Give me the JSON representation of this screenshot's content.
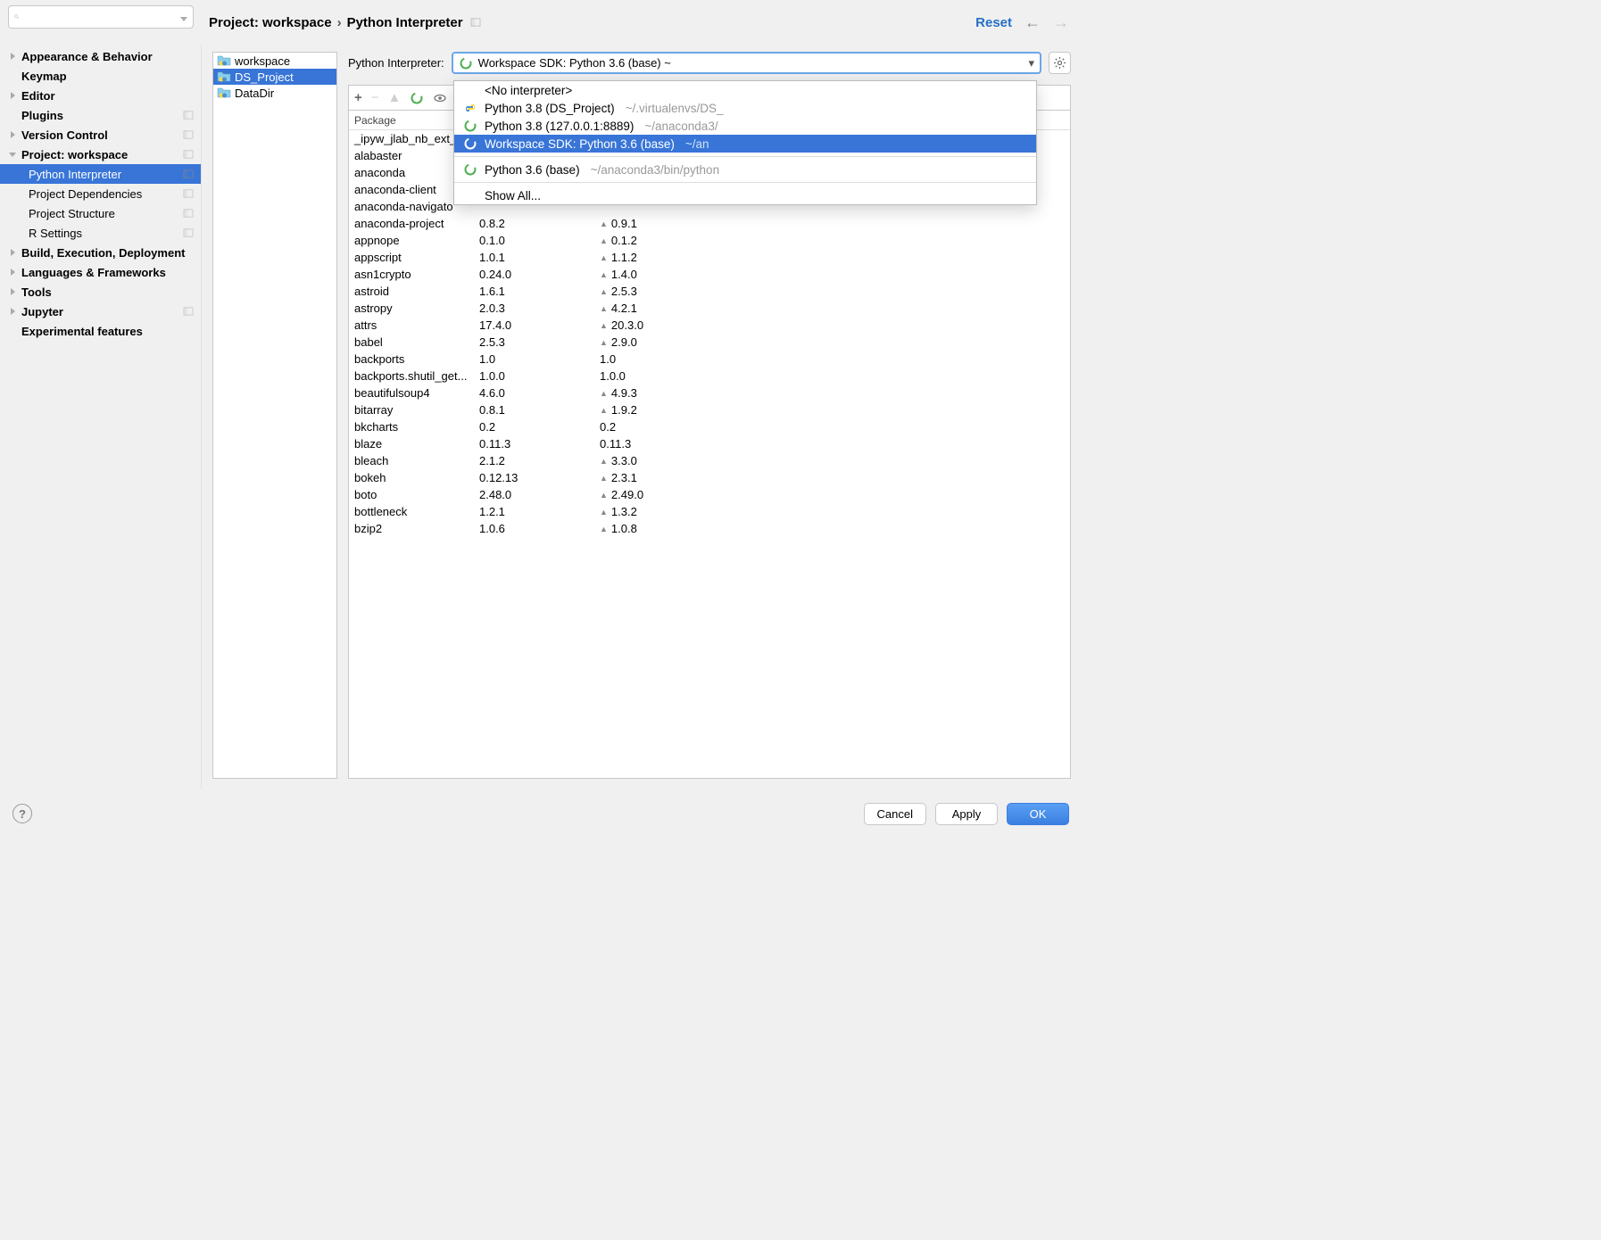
{
  "search": {
    "placeholder": ""
  },
  "breadcrumb": {
    "root": "Project: workspace",
    "sep": "›",
    "leaf": "Python Interpreter"
  },
  "topActions": {
    "reset": "Reset"
  },
  "sidebar": {
    "items": [
      {
        "label": "Appearance & Behavior",
        "arrow": "right",
        "bold": true
      },
      {
        "label": "Keymap",
        "bold": true
      },
      {
        "label": "Editor",
        "arrow": "right",
        "bold": true
      },
      {
        "label": "Plugins",
        "bold": true,
        "pane": true
      },
      {
        "label": "Version Control",
        "arrow": "right",
        "bold": true,
        "pane": true
      },
      {
        "label": "Project: workspace",
        "arrow": "down",
        "bold": true,
        "pane": true
      },
      {
        "label": "Python Interpreter",
        "child": true,
        "selected": true,
        "pane": true
      },
      {
        "label": "Project Dependencies",
        "child": true,
        "pane": true
      },
      {
        "label": "Project Structure",
        "child": true,
        "pane": true
      },
      {
        "label": "R Settings",
        "child": true,
        "pane": true
      },
      {
        "label": "Build, Execution, Deployment",
        "arrow": "right",
        "bold": true
      },
      {
        "label": "Languages & Frameworks",
        "arrow": "right",
        "bold": true
      },
      {
        "label": "Tools",
        "arrow": "right",
        "bold": true
      },
      {
        "label": "Jupyter",
        "arrow": "right",
        "bold": true,
        "pane": true
      },
      {
        "label": "Experimental features",
        "bold": true
      }
    ]
  },
  "projectTree": {
    "items": [
      {
        "label": "workspace"
      },
      {
        "label": "DS_Project",
        "selected": true
      },
      {
        "label": "DataDir"
      }
    ]
  },
  "interpreter": {
    "label": "Python Interpreter:",
    "selected": "Workspace SDK: Python 3.6 (base) ~"
  },
  "dropdown": {
    "noInterp": "<No interpreter>",
    "items": [
      {
        "icon": "python",
        "label": "Python 3.8 (DS_Project)",
        "path": "~/.virtualenvs/DS_"
      },
      {
        "icon": "ring",
        "label": "Python 3.8 (127.0.0.1:8889)",
        "path": "~/anaconda3/"
      },
      {
        "icon": "ring",
        "label": "Workspace SDK: Python 3.6 (base)",
        "path": "~/an",
        "selected": true
      },
      {
        "sep": true
      },
      {
        "icon": "ring",
        "label": "Python 3.6 (base)",
        "path": "~/anaconda3/bin/python"
      },
      {
        "sep": true
      },
      {
        "label": "Show All...",
        "noicon": true
      }
    ]
  },
  "packageTable": {
    "header": "Package",
    "rows": [
      {
        "name": "_ipyw_jlab_nb_ext_"
      },
      {
        "name": "alabaster"
      },
      {
        "name": "anaconda"
      },
      {
        "name": "anaconda-client"
      },
      {
        "name": "anaconda-navigato"
      },
      {
        "name": "anaconda-project",
        "version": "0.8.2",
        "latest": "0.9.1",
        "up": true
      },
      {
        "name": "appnope",
        "version": "0.1.0",
        "latest": "0.1.2",
        "up": true
      },
      {
        "name": "appscript",
        "version": "1.0.1",
        "latest": "1.1.2",
        "up": true
      },
      {
        "name": "asn1crypto",
        "version": "0.24.0",
        "latest": "1.4.0",
        "up": true
      },
      {
        "name": "astroid",
        "version": "1.6.1",
        "latest": "2.5.3",
        "up": true
      },
      {
        "name": "astropy",
        "version": "2.0.3",
        "latest": "4.2.1",
        "up": true
      },
      {
        "name": "attrs",
        "version": "17.4.0",
        "latest": "20.3.0",
        "up": true
      },
      {
        "name": "babel",
        "version": "2.5.3",
        "latest": "2.9.0",
        "up": true
      },
      {
        "name": "backports",
        "version": "1.0",
        "latest": "1.0"
      },
      {
        "name": "backports.shutil_get...",
        "version": "1.0.0",
        "latest": "1.0.0"
      },
      {
        "name": "beautifulsoup4",
        "version": "4.6.0",
        "latest": "4.9.3",
        "up": true
      },
      {
        "name": "bitarray",
        "version": "0.8.1",
        "latest": "1.9.2",
        "up": true
      },
      {
        "name": "bkcharts",
        "version": "0.2",
        "latest": "0.2"
      },
      {
        "name": "blaze",
        "version": "0.11.3",
        "latest": "0.11.3"
      },
      {
        "name": "bleach",
        "version": "2.1.2",
        "latest": "3.3.0",
        "up": true
      },
      {
        "name": "bokeh",
        "version": "0.12.13",
        "latest": "2.3.1",
        "up": true
      },
      {
        "name": "boto",
        "version": "2.48.0",
        "latest": "2.49.0",
        "up": true
      },
      {
        "name": "bottleneck",
        "version": "1.2.1",
        "latest": "1.3.2",
        "up": true
      },
      {
        "name": "bzip2",
        "version": "1.0.6",
        "latest": "1.0.8",
        "up": true
      }
    ]
  },
  "footer": {
    "cancel": "Cancel",
    "apply": "Apply",
    "ok": "OK"
  }
}
